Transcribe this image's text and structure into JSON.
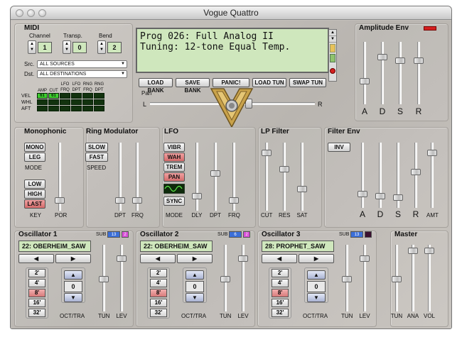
{
  "window": {
    "title": "Vogue Quattro"
  },
  "midi": {
    "title": "MIDI",
    "channel_label": "Channel",
    "transp_label": "Transp.",
    "bend_label": "Bend",
    "channel": "1",
    "transp": "0",
    "bend": "2",
    "src_label": "Src.",
    "src_value": "ALL SOURCES",
    "dst_label": "Dst.",
    "dst_value": "ALL DESTINATIONS",
    "matrix_cols": [
      "AMP",
      "CUT",
      "LFO FRQ",
      "LFO DPT",
      "RNG FRQ",
      "RNG DPT"
    ],
    "matrix_rows": [
      "VEL",
      "WHL",
      "AFT"
    ],
    "vel_amp": "61",
    "vel_cut": "61"
  },
  "display": {
    "line1": "Prog 026: Full Analog II",
    "line2": "Tuning: 12-tone Equal Temp.",
    "buttons": [
      "LOAD BANK",
      "SAVE BANK",
      "PANIC!",
      "LOAD TUN",
      "SWAP TUN"
    ],
    "pan_label": "Pan",
    "pan_left": "L",
    "pan_right": "R",
    "pan_value": 0.6
  },
  "amp_env": {
    "title": "Amplitude Env",
    "labels": [
      "A",
      "D",
      "S",
      "R"
    ],
    "values": [
      0.35,
      0.78,
      0.72,
      0.72
    ],
    "indicator_color": "#d42020"
  },
  "monophonic": {
    "title": "Monophonic",
    "mono": "MONO",
    "leg": "LEG",
    "mode_label": "MODE",
    "low": "LOW",
    "high": "HIGH",
    "last": "LAST",
    "key_label": "KEY",
    "por_label": "POR",
    "por_value": 0.12
  },
  "ring": {
    "title": "Ring Modulator",
    "slow": "SLOW",
    "fast": "FAST",
    "speed_label": "SPEED",
    "labels": [
      "DPT",
      "FRQ"
    ],
    "values": [
      0.12,
      0.12
    ]
  },
  "lfo": {
    "title": "LFO",
    "buttons": [
      "VIBR",
      "WAH",
      "TREM",
      "PAN"
    ],
    "sync": "SYNC",
    "mode_label": "MODE",
    "labels": [
      "DLY",
      "DPT",
      "FRQ"
    ],
    "values": [
      0.18,
      0.55,
      0.12
    ]
  },
  "lp_filter": {
    "title": "LP Filter",
    "labels": [
      "CUT",
      "RES",
      "SAT"
    ],
    "values": [
      0.88,
      0.62,
      0.3
    ]
  },
  "filter_env": {
    "title": "Filter Env",
    "inv": "INV",
    "labels": [
      "A",
      "D",
      "S",
      "R",
      "AMT"
    ],
    "values": [
      0.18,
      0.15,
      0.12,
      0.55,
      0.88
    ]
  },
  "oscillators": [
    {
      "title": "Oscillator 1",
      "sub_label": "SUB",
      "sub_val": "13",
      "sub_num": "2",
      "wave": "22: OBERHEIM_SAW",
      "octs": [
        "2'",
        "4'",
        "8'",
        "16'",
        "32'"
      ],
      "active_oct": "8'",
      "tra": "0",
      "oct_label": "OCT/TRA",
      "tun_label": "TUN",
      "lev_label": "LEV",
      "tun": 0.48,
      "lev": 0.82
    },
    {
      "title": "Oscillator 2",
      "sub_label": "SUB",
      "sub_val": "6",
      "sub_num": "2",
      "wave": "22: OBERHEIM_SAW",
      "octs": [
        "2'",
        "4'",
        "8'",
        "16'",
        "32'"
      ],
      "active_oct": "8'",
      "tra": "0",
      "oct_label": "OCT/TRA",
      "tun_label": "TUN",
      "lev_label": "LEV",
      "tun": 0.48,
      "lev": 0.82
    },
    {
      "title": "Oscillator 3",
      "sub_label": "SUB",
      "sub_val": "13",
      "sub_num": "",
      "wave": "28: PROPHET_SAW",
      "octs": [
        "2'",
        "4'",
        "8'",
        "16'",
        "32'"
      ],
      "active_oct": "8'",
      "tra": "0",
      "oct_label": "OCT/TRA",
      "tun_label": "TUN",
      "lev_label": "LEV",
      "tun": 0.48,
      "lev": 0.82
    }
  ],
  "master": {
    "title": "Master",
    "labels": [
      "TUN",
      "ANA",
      "VOL"
    ],
    "values": [
      0.48,
      0.95,
      0.95
    ]
  },
  "colors": {
    "lcd_bg": "#cfe7bd",
    "active_red": "#d77a7a",
    "sub_blue": "#3b6fd8",
    "sub_pink": "#d84fd8"
  }
}
